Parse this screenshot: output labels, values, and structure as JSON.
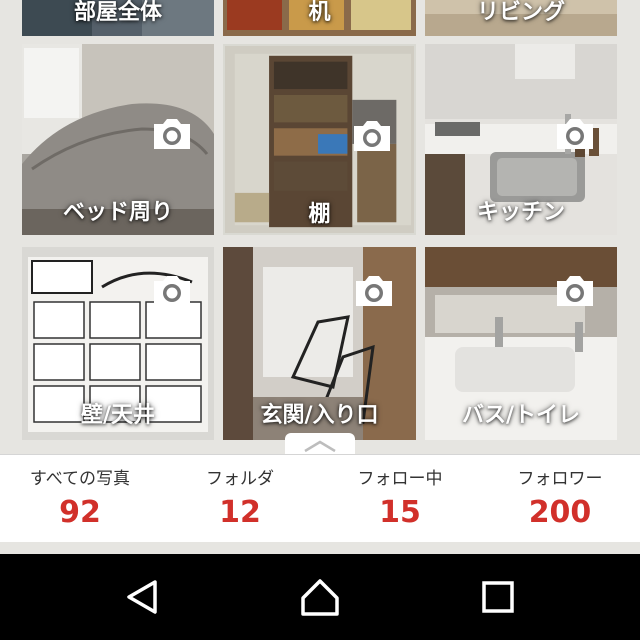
{
  "folders": {
    "row0": [
      {
        "label": "部屋全体"
      },
      {
        "label": "机"
      },
      {
        "label": "リビング"
      }
    ],
    "row1": [
      {
        "label": "ベッド周り"
      },
      {
        "label": "棚"
      },
      {
        "label": "キッチン"
      }
    ],
    "row2": [
      {
        "label": "壁/天井"
      },
      {
        "label": "玄関/入り口"
      },
      {
        "label": "バス/トイレ"
      }
    ]
  },
  "stats": [
    {
      "label": "すべての写真",
      "value": "92"
    },
    {
      "label": "フォルダ",
      "value": "12"
    },
    {
      "label": "フォロー中",
      "value": "15"
    },
    {
      "label": "フォロワー",
      "value": "200"
    }
  ],
  "icons": {
    "tile_badge": "camera-icon",
    "nav": [
      "back-icon",
      "home-icon",
      "recents-icon"
    ],
    "pull_tab": "chevron-up-icon"
  },
  "colors": {
    "accent": "#d1302a",
    "page_background": "#e6e5e1",
    "nav_bar": "#000000"
  }
}
